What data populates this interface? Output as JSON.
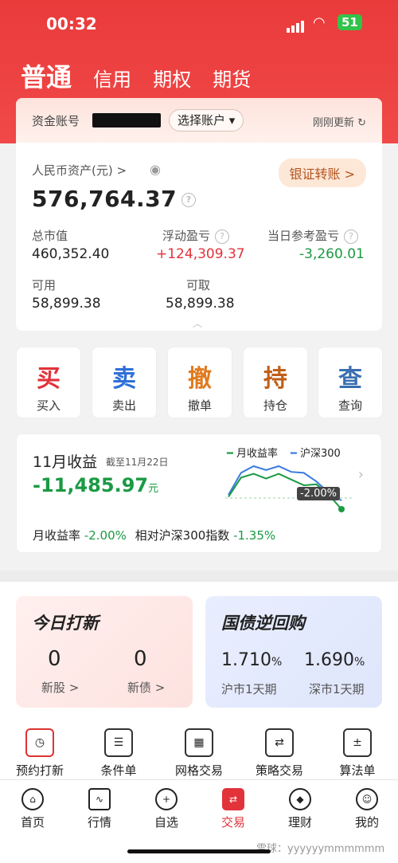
{
  "status": {
    "time": "00:32",
    "battery": "51"
  },
  "tabs": [
    "普通",
    "信用",
    "期权",
    "期货"
  ],
  "account": {
    "label": "资金账号",
    "select": "选择账户 ▾",
    "updated": "刚刚更新 ↻"
  },
  "asset": {
    "label": "人民币资产(元)  >",
    "bank_transfer": "银证转账 >",
    "total": "576,764.37"
  },
  "stats": {
    "market_value_label": "总市值",
    "market_value": "460,352.40",
    "float_pl_label": "浮动盈亏",
    "float_pl": "+124,309.37",
    "day_pl_label": "当日参考盈亏",
    "day_pl": "-3,260.01",
    "available_label": "可用",
    "available": "58,899.38",
    "withdrawable_label": "可取",
    "withdrawable": "58,899.38"
  },
  "trade_buttons": [
    {
      "big": "买",
      "small": "买入",
      "color": "#e2323a"
    },
    {
      "big": "卖",
      "small": "卖出",
      "color": "#2f6fd8"
    },
    {
      "big": "撤",
      "small": "撤单",
      "color": "#e07a1f"
    },
    {
      "big": "持",
      "small": "持仓",
      "color": "#c0601a"
    },
    {
      "big": "查",
      "small": "查询",
      "color": "#3a6fb0"
    }
  ],
  "profit": {
    "title": "11月收益",
    "as_of": "截至11月22日",
    "amount": "-11,485.97",
    "unit": "元",
    "legend_monthly": "月收益率",
    "legend_hs300": "沪深300",
    "end_label": "-2.00%",
    "rate_label": "月收益率",
    "rate": "-2.00%",
    "rel_label": "相对沪深300指数",
    "rel": "-1.35%"
  },
  "chart_data": {
    "type": "line",
    "series": [
      {
        "name": "月收益率",
        "values": [
          -0.6,
          1.4,
          1.8,
          1.3,
          1.8,
          1.2,
          0.6,
          0.7,
          -0.4,
          -1.9
        ]
      },
      {
        "name": "沪深300",
        "values": [
          -0.4,
          1.9,
          2.6,
          2.2,
          2.6,
          2.0,
          1.9,
          1.0,
          -0.2,
          -1.0
        ]
      }
    ]
  },
  "promo": {
    "ipo_title": "今日打新",
    "ipo_stock_count": "0",
    "ipo_stock_label": "新股 >",
    "ipo_bond_count": "0",
    "ipo_bond_label": "新债 >",
    "repo_title": "国债逆回购",
    "sh_rate": "1.710",
    "sh_label": "沪市1天期",
    "sz_rate": "1.690",
    "sz_label": "深市1天期",
    "percent": "%"
  },
  "quick_icons": [
    "预约打新",
    "条件单",
    "网格交易",
    "策略交易",
    "算法单"
  ],
  "bottom_tabs": [
    "首页",
    "行情",
    "自选",
    "交易",
    "理财",
    "我的"
  ],
  "watermark": "雪球：yyyyyymmmmmm"
}
